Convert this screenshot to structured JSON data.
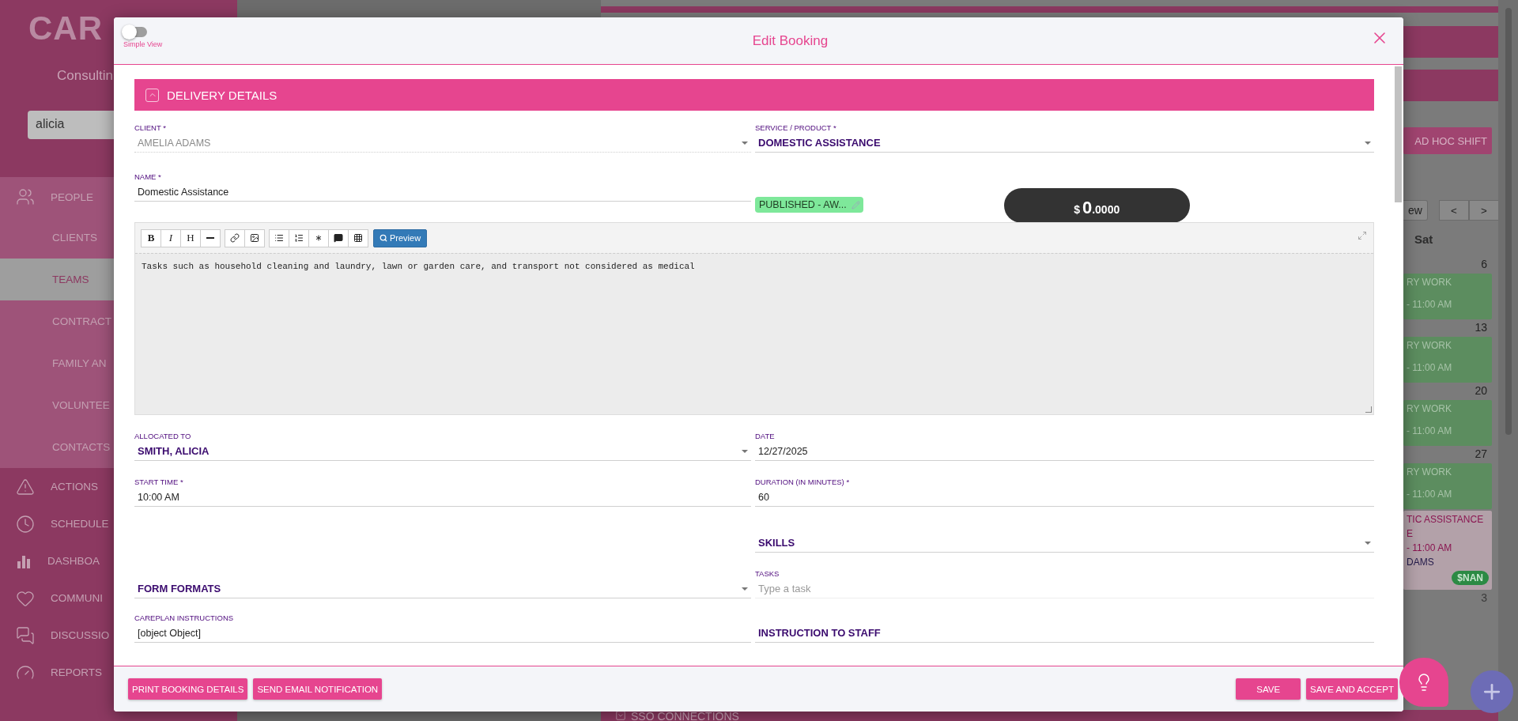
{
  "sidebar": {
    "logo": "CAR",
    "subtitle": "Consultin",
    "search": {
      "value": "alicia"
    },
    "items": [
      {
        "label": "PEOPLE",
        "selected": false,
        "children": [
          {
            "label": "CLIENTS",
            "selected": false
          },
          {
            "label": "TEAMS",
            "selected": true
          },
          {
            "label": "CONTRACT",
            "selected": false
          },
          {
            "label": "FAMILY AN",
            "selected": false
          },
          {
            "label": "VOLUNTEE",
            "selected": false
          },
          {
            "label": "CONTACTS",
            "selected": false
          }
        ]
      },
      {
        "label": "ACTIONS",
        "selected": false
      },
      {
        "label": "SCHEDULE",
        "selected": false
      },
      {
        "label": "DASHBOA",
        "selected": false
      },
      {
        "label": "COMMUNI",
        "selected": false
      },
      {
        "label": "DISCUSSIO",
        "selected": false
      },
      {
        "label": "REPORTS",
        "selected": false
      }
    ]
  },
  "calendar": {
    "add_button": "AD HOC SHIFT",
    "view_button": "ew",
    "nav": [
      "<",
      ">"
    ],
    "day_header": "Sat",
    "weeks": [
      {
        "day": "6",
        "events": [
          {
            "kind": "work",
            "title": "RY WORK",
            "time": "- 11:00 AM"
          }
        ]
      },
      {
        "day": "13",
        "events": [
          {
            "kind": "work",
            "title": "RY WORK",
            "time": "- 11:00 AM"
          }
        ]
      },
      {
        "day": "20",
        "events": [
          {
            "kind": "work",
            "title": "RY WORK",
            "time": "- 11:00 AM"
          }
        ]
      },
      {
        "day": "27",
        "events": [
          {
            "kind": "work",
            "title": "RY WORK",
            "time": "- 11:00 AM"
          },
          {
            "kind": "service",
            "title": "TIC ASSISTANCE",
            "subtitle": "E",
            "time": "- 11:00 AM",
            "client": "DAMS",
            "price": "$NAN"
          }
        ]
      },
      {
        "day": "3"
      }
    ],
    "bottom_section": "SSO CONNECTIONS"
  },
  "modal": {
    "simple_view": {
      "label": "Simple View",
      "on": false
    },
    "title": "Edit Booking",
    "section": {
      "title": "DELIVERY DETAILS",
      "expanded": true
    },
    "rows": [
      {
        "left": {
          "kind": "select",
          "label": "CLIENT *",
          "value": "AMELIA ADAMS",
          "disabled": true
        },
        "right": {
          "kind": "select",
          "label": "SERVICE / PRODUCT *",
          "value": "DOMESTIC ASSISTANCE",
          "disabled": false
        }
      },
      {
        "left": {
          "kind": "text",
          "label": "NAME *",
          "value": "Domestic Assistance"
        },
        "right": {
          "kind": "status",
          "status": "PUBLISHED - AW...",
          "color": "#7ee89a",
          "currency": "$",
          "amount": "0",
          "decimals": ".0000"
        }
      },
      {
        "kind": "editor",
        "text_buttons": [
          "B",
          "I",
          "H"
        ],
        "preview": "Preview",
        "content": "Tasks such as household cleaning and laundry, lawn or garden care, and transport not considered as medical"
      },
      {
        "left": {
          "kind": "select",
          "label": "ALLOCATED TO",
          "value": "SMITH, ALICIA",
          "disabled": false
        },
        "right": {
          "kind": "text",
          "label": "DATE",
          "value": "12/27/2025"
        }
      },
      {
        "left": {
          "kind": "text",
          "label": "START TIME *",
          "value": "10:00  AM"
        },
        "right": {
          "kind": "text",
          "label": "DURATION (IN MINUTES) *",
          "value": "60"
        }
      },
      {
        "right": {
          "kind": "heading_select",
          "value": "SKILLS"
        }
      },
      {
        "left": {
          "kind": "heading_select",
          "value": "FORM FORMATS"
        },
        "right": {
          "kind": "input",
          "label": "TASKS",
          "placeholder": "Type a task"
        }
      },
      {
        "left": {
          "kind": "text",
          "label": "CAREPLAN INSTRUCTIONS",
          "value": "[object Object]"
        },
        "right": {
          "kind": "heading",
          "value": "INSTRUCTION TO STAFF"
        }
      }
    ],
    "left_buttons": [
      "PRINT BOOKING DETAILS",
      "SEND EMAIL NOTIFICATION"
    ],
    "right_buttons": [
      "SAVE",
      "SAVE AND ACCEPT"
    ]
  }
}
